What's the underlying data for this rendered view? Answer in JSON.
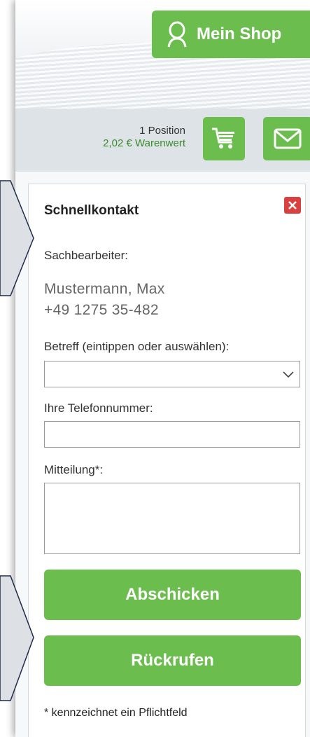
{
  "header": {
    "shop_button_label": "Mein Shop"
  },
  "cart": {
    "positions": "1 Position",
    "value": "2,02 € Warenwert"
  },
  "quick_contact": {
    "title": "Schnellkontakt",
    "agent_label": "Sachbearbeiter:",
    "agent_name": "Mustermann, Max",
    "agent_phone": "+49 1275 35-482",
    "subject_label": "Betreff (eintippen oder auswählen):",
    "subject_value": "",
    "phone_label": "Ihre Telefonnummer:",
    "phone_value": "",
    "message_label": "Mitteilung*:",
    "message_value": "",
    "send_button": "Abschicken",
    "callback_button": "Rückrufen",
    "required_note": "* kennzeichnet ein Pflichtfeld"
  },
  "colors": {
    "accent_green": "#6bbd4e",
    "close_red": "#d94040",
    "value_green": "#3c8a2e",
    "overlay_arrow": "#dde1e6"
  }
}
